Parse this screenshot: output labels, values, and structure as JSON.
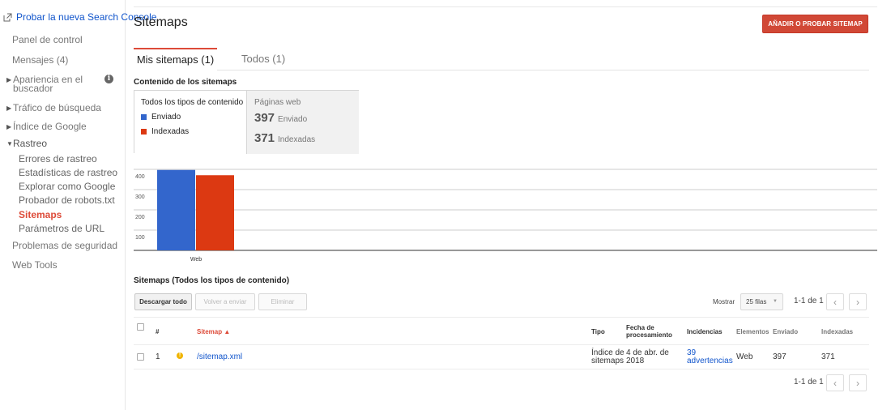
{
  "sidebar": {
    "new_search_console": "Probar la nueva Search Console",
    "dashboard": "Panel de control",
    "messages": "Mensajes (4)",
    "search_appearance_line1": "Apariencia en el",
    "search_appearance_line2": "buscador",
    "search_traffic": "Tráfico de búsqueda",
    "google_index": "Índice de Google",
    "crawl": "Rastreo",
    "crawl_items": [
      "Errores de rastreo",
      "Estadísticas de rastreo",
      "Explorar como Google",
      "Probador de robots.txt",
      "Sitemaps",
      "Parámetros de URL"
    ],
    "security": "Problemas de seguridad",
    "web_tools": "Web Tools",
    "info_glyph": "i"
  },
  "header": {
    "title": "Sitemaps",
    "add_button": "AÑADIR O PROBAR SITEMAP"
  },
  "tabs": [
    {
      "label": "Mis sitemaps (1)",
      "active": true
    },
    {
      "label": "Todos (1)",
      "active": false
    }
  ],
  "content_box": {
    "heading": "Contenido de los sitemaps",
    "all_types": "Todos los tipos de contenido",
    "legend": [
      {
        "label": "Enviado",
        "color": "#3366cc"
      },
      {
        "label": "Indexadas",
        "color": "#dc3912"
      }
    ],
    "web_pages_label": "Páginas web",
    "submitted_value": "397",
    "submitted_label": "Enviado",
    "indexed_value": "371",
    "indexed_label": "Indexadas"
  },
  "chart_data": {
    "type": "bar",
    "categories": [
      "Web"
    ],
    "series": [
      {
        "name": "Enviado",
        "values": [
          397
        ],
        "color": "#3366cc"
      },
      {
        "name": "Indexadas",
        "values": [
          371
        ],
        "color": "#dc3912"
      }
    ],
    "yticks": [
      100,
      200,
      300,
      400
    ],
    "ylim": [
      0,
      400
    ],
    "grid": true,
    "legend": "top-left"
  },
  "table": {
    "heading": "Sitemaps (Todos los tipos de contenido)",
    "download_all": "Descargar todo",
    "resend": "Volver a enviar",
    "delete": "Eliminar",
    "show_label": "Mostrar",
    "rows_option": "25 filas",
    "pager_top": "1-1 de 1",
    "pager_bottom": "1-1 de 1",
    "prev_glyph": "‹",
    "next_glyph": "›",
    "dropdown_glyph": "▼",
    "columns": {
      "num": "#",
      "sitemap": "Sitemap ▲",
      "type": "Tipo",
      "date_line1": "Fecha de",
      "date_line2": "procesamiento",
      "issues": "Incidencias",
      "items": "Elementos",
      "submitted": "Enviado",
      "indexed": "Indexadas"
    },
    "rows": [
      {
        "num": "1",
        "warn_glyph": "!",
        "sitemap": "/sitemap.xml",
        "type_line1": "Índice de",
        "type_line2": "sitemaps",
        "date_line1": "4 de abr. de",
        "date_line2": "2018",
        "issues_line1": "39",
        "issues_line2": "advertencias",
        "items": "Web",
        "submitted": "397",
        "indexed": "371"
      }
    ]
  }
}
